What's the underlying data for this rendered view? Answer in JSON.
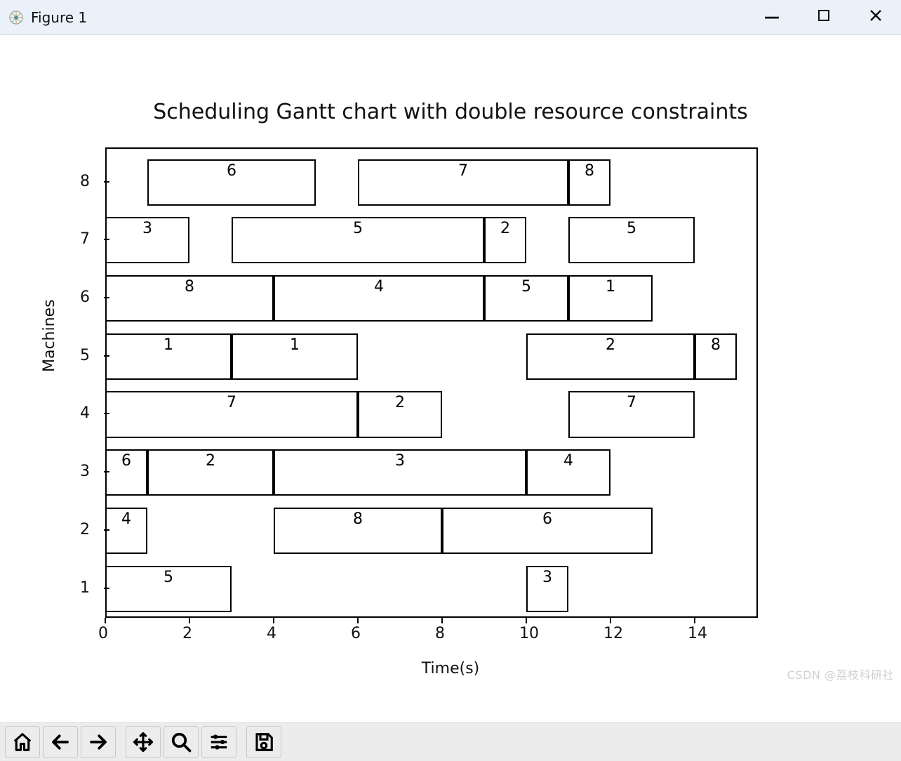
{
  "window": {
    "title": "Figure 1",
    "controls": {
      "minimize": "—",
      "maximize": "▢",
      "close": "✕"
    }
  },
  "chart_title": "Scheduling Gantt chart with double resource constraints",
  "xlabel": "Time(s)",
  "ylabel": "Machines",
  "watermark": "CSDN @荔枝科研社",
  "toolbar": {
    "home": "home",
    "back": "back",
    "forward": "forward",
    "pan": "pan",
    "zoom": "zoom",
    "configure": "configure",
    "save": "save"
  },
  "chart_data": {
    "type": "bar",
    "orientation": "gantt",
    "xlim": [
      0,
      15.5
    ],
    "ylim": [
      0.5,
      8.6
    ],
    "xticks": [
      0,
      2,
      4,
      6,
      8,
      10,
      12,
      14
    ],
    "yticks": [
      1,
      2,
      3,
      4,
      5,
      6,
      7,
      8
    ],
    "xlabel": "Time(s)",
    "ylabel": "Machines",
    "title": "Scheduling Gantt chart with double resource constraints",
    "bar_height": 0.8,
    "series": [
      {
        "machine": 1,
        "tasks": [
          {
            "label": "5",
            "start": 0,
            "end": 3
          },
          {
            "label": "3",
            "start": 10,
            "end": 11
          }
        ]
      },
      {
        "machine": 2,
        "tasks": [
          {
            "label": "4",
            "start": 0,
            "end": 1
          },
          {
            "label": "8",
            "start": 4,
            "end": 8
          },
          {
            "label": "6",
            "start": 8,
            "end": 13
          }
        ]
      },
      {
        "machine": 3,
        "tasks": [
          {
            "label": "6",
            "start": 0,
            "end": 1
          },
          {
            "label": "2",
            "start": 1,
            "end": 4
          },
          {
            "label": "3",
            "start": 4,
            "end": 10
          },
          {
            "label": "4",
            "start": 10,
            "end": 12
          }
        ]
      },
      {
        "machine": 4,
        "tasks": [
          {
            "label": "7",
            "start": 0,
            "end": 6
          },
          {
            "label": "2",
            "start": 6,
            "end": 8
          },
          {
            "label": "7",
            "start": 11,
            "end": 14
          }
        ]
      },
      {
        "machine": 5,
        "tasks": [
          {
            "label": "1",
            "start": 0,
            "end": 3
          },
          {
            "label": "1",
            "start": 3,
            "end": 6
          },
          {
            "label": "2",
            "start": 10,
            "end": 14
          },
          {
            "label": "8",
            "start": 14,
            "end": 15
          }
        ]
      },
      {
        "machine": 6,
        "tasks": [
          {
            "label": "8",
            "start": 0,
            "end": 4
          },
          {
            "label": "4",
            "start": 4,
            "end": 9
          },
          {
            "label": "5",
            "start": 9,
            "end": 11
          },
          {
            "label": "1",
            "start": 11,
            "end": 13
          }
        ]
      },
      {
        "machine": 7,
        "tasks": [
          {
            "label": "3",
            "start": 0,
            "end": 2
          },
          {
            "label": "5",
            "start": 3,
            "end": 9
          },
          {
            "label": "2",
            "start": 9,
            "end": 10
          },
          {
            "label": "5",
            "start": 11,
            "end": 14
          }
        ]
      },
      {
        "machine": 8,
        "tasks": [
          {
            "label": "6",
            "start": 1,
            "end": 5
          },
          {
            "label": "7",
            "start": 6,
            "end": 11
          },
          {
            "label": "8",
            "start": 11,
            "end": 12
          }
        ]
      }
    ]
  }
}
